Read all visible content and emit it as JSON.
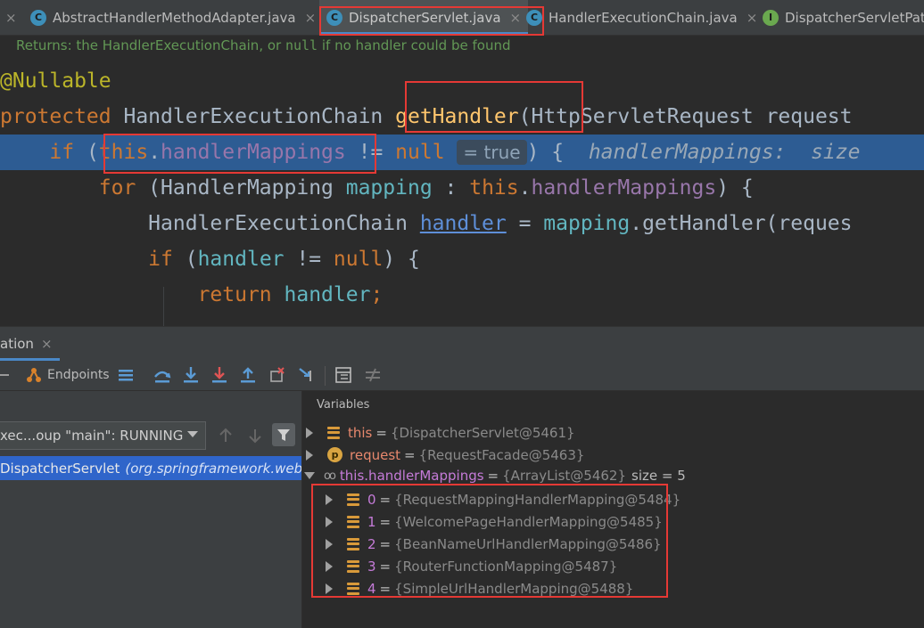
{
  "tabs": [
    {
      "label": "AbstractHandlerMethodAdapter.java",
      "icon": "class-icon",
      "active": false
    },
    {
      "label": "DispatcherServlet.java",
      "icon": "class-icon",
      "active": true
    },
    {
      "label": "HandlerExecutionChain.java",
      "icon": "class-icon",
      "active": false
    },
    {
      "label": "DispatcherServletPath",
      "icon": "interface-icon",
      "active": false
    }
  ],
  "tab_close_glyph": "×",
  "editor": {
    "doc_prefix": "Returns: the HandlerExecutionChain, or ",
    "doc_code": "null",
    "doc_suffix": " if no handler could be found",
    "annotation": "@Nullable",
    "line_method": {
      "kw": "protected",
      "type": "HandlerExecutionChain",
      "name": "getHandler",
      "paren": "(HttpServletRequest request"
    },
    "line_if": {
      "kw": "if",
      "open": " (",
      "this": "this",
      "dot": ".",
      "field": "handlerMappings",
      "op": " != ",
      "null": "null",
      "hint": "= true",
      "close": ") {",
      "debug": "handlerMappings:  size"
    },
    "line_for": {
      "kw": "for",
      "open": " (HandlerMapping ",
      "var": "mapping",
      "sep": " : ",
      "this": "this",
      "dot": ".",
      "field": "handlerMappings",
      "close": ") {"
    },
    "line_handler": {
      "type": "HandlerExecutionChain ",
      "var": "handler",
      "assign": " = ",
      "obj": "mapping",
      "call": ".getHandler(reques"
    },
    "line_if2": {
      "kw": "if",
      "open": " (",
      "var": "handler",
      "op": " != ",
      "null": "null",
      "close": ") {"
    },
    "line_return": {
      "kw": "return",
      "sp": " ",
      "var": "handler",
      "semi": ";"
    }
  },
  "debug_tab": {
    "label": "ation",
    "close": "×"
  },
  "toolbar": {
    "endpoints_label": "Endpoints"
  },
  "frames": {
    "thread_select": "xec...oup \"main\": RUNNING",
    "frame0_class": "DispatcherServlet",
    "frame0_pkg": "(org.springframework.web.se"
  },
  "variables": {
    "header": "Variables",
    "rows": [
      {
        "name": "this",
        "value": "{DispatcherServlet@5461}"
      },
      {
        "name": "request",
        "value": "{RequestFacade@5463}"
      },
      {
        "name": "this.handlerMappings",
        "value": "{ArrayList@5462}",
        "size": "size = 5"
      }
    ],
    "children": [
      {
        "name": "0",
        "value": "{RequestMappingHandlerMapping@5484}"
      },
      {
        "name": "1",
        "value": "{WelcomePageHandlerMapping@5485}"
      },
      {
        "name": "2",
        "value": "{BeanNameUrlHandlerMapping@5486}"
      },
      {
        "name": "3",
        "value": "{RouterFunctionMapping@5487}"
      },
      {
        "name": "4",
        "value": "{SimpleUrlHandlerMapping@5488}"
      }
    ],
    "eq": "="
  },
  "colors": {
    "highlight_box": "#e53935",
    "selected_line": "#2d5c93",
    "active_tab_underline": "#4a88c7"
  }
}
